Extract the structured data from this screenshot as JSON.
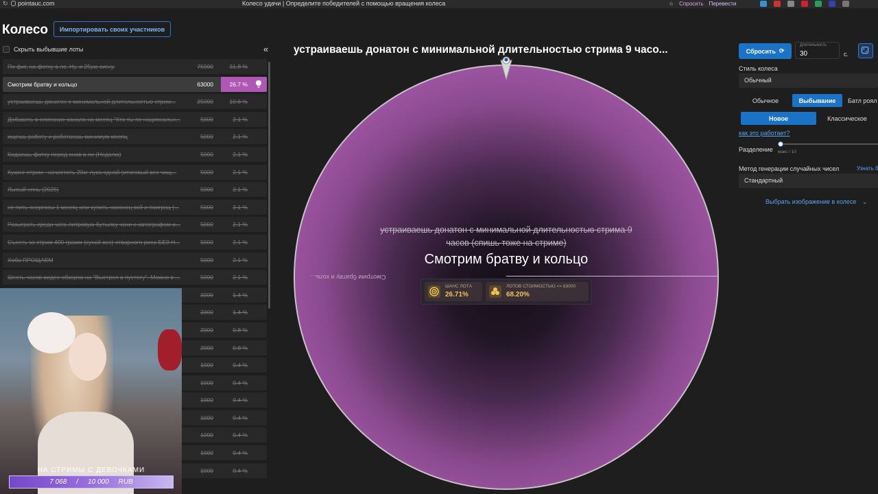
{
  "browser": {
    "url": "pointauc.com",
    "page_title": "Колесо удачи | Определите победителей с помощью вращения колеса",
    "ext_ask": "Спросить",
    "ext_translate": "Перевести"
  },
  "header": {
    "title": "Колесо",
    "import_label": "Импортировать своих участников"
  },
  "sidebar": {
    "hide_lots_label": "Скрыть выбывшие лоты",
    "collapse_icon": "«",
    "lots": [
      {
        "title": "По фиг, на фотку в лс. Ну, и 25ую сигну.",
        "amount": "75000",
        "percent": "31.8 %"
      },
      {
        "title": "Смотрим братву и кольцо",
        "amount": "63000",
        "percent": "26.7 %",
        "active": true
      },
      {
        "title": "устраиваешь донатон с минимальной длительностью стрим...",
        "amount": "25000",
        "percent": "10.6 %"
      },
      {
        "title": "Добавить в описание канала на месяц \"Кто ты по национальн...",
        "amount": "5000",
        "percent": "2.1 %"
      },
      {
        "title": "ищешь работу и работаешь минимум месяц",
        "amount": "5000",
        "percent": "2.1 %"
      },
      {
        "title": "Кидаешь фотку перед снов в лс (Неделю)",
        "amount": "5000",
        "percent": "2.1 %"
      },
      {
        "title": "Кукинг стрим - начистить 20кг лука одной (итоговый вес чищ...",
        "amount": "5000",
        "percent": "2.1 %"
      },
      {
        "title": "Лысый нянь (2025)",
        "amount": "5000",
        "percent": "2.1 %"
      },
      {
        "title": "не пить энергосы 1 месяц или купить наконец вк3 и поиграц (...",
        "amount": "5000",
        "percent": "2.1 %"
      },
      {
        "title": "Разыграть среди чата литровую бутылку чачи с автографом и...",
        "amount": "5000",
        "percent": "2.1 %"
      },
      {
        "title": "Съесть за стрим 400 грамм (сухой вес) отварного риса БЕЗ Н...",
        "amount": "5000",
        "percent": "2.1 %"
      },
      {
        "title": "Хоба ПРОЩАЕМ",
        "amount": "5000",
        "percent": "2.1 %"
      },
      {
        "title": "Шесть часов видео обзоров на \"Выстрел в пустоту\". Можно в ...",
        "amount": "5000",
        "percent": "2.1 %"
      },
      {
        "title": "",
        "amount": "3300",
        "percent": "1.4 %"
      },
      {
        "title": "",
        "amount": "3300",
        "percent": "1.4 %"
      },
      {
        "title": "",
        "amount": "2000",
        "percent": "0.8 %"
      },
      {
        "title": "",
        "amount": "2000",
        "percent": "0.8 %"
      },
      {
        "title": "",
        "amount": "1000",
        "percent": "0.4 %"
      },
      {
        "title": "",
        "amount": "1000",
        "percent": "0.4 %"
      },
      {
        "title": "",
        "amount": "1000",
        "percent": "0.4 %"
      },
      {
        "title": "",
        "amount": "1000",
        "percent": "0.4 %"
      },
      {
        "title": "",
        "amount": "1000",
        "percent": "0.4 %"
      },
      {
        "title": "",
        "amount": "1000",
        "percent": "0.4 %"
      },
      {
        "title": "",
        "amount": "1000",
        "percent": "0.4 %"
      }
    ]
  },
  "webcam": {
    "banner_label": "НА СТРИМЫ С ДЕВОЧКАМИ",
    "progress_current": "7 068",
    "progress_sep": "/",
    "progress_goal": "10 000",
    "progress_currency": "RUB",
    "progress_fraction": 0.7068
  },
  "wheel": {
    "title": "устраиваешь донатон с минимальной длительностью стрима 9 часо...",
    "sector_label": "Смотрим братву и коль...",
    "previous_winner": "устраиваешь донатон с минимальной длительностью стрима 9 часов (спишь тоже на стриме)",
    "current_winner": "Смотрим братву и кольцо",
    "stat1_caption": "ШАНС ЛОТА",
    "stat1_value": "26.71%",
    "stat2_caption": "ЛОТОВ СТОИМОСТЬЮ <= 63000",
    "stat2_value": "68.20%",
    "color": "#b056b5"
  },
  "controls": {
    "reset_label": "Сбросить",
    "duration_caption": "Длительность",
    "duration_value": "30",
    "duration_unit": "с.",
    "wheel_style_label": "Стиль колеса",
    "wheel_style_value": "Обычный",
    "mode_tabs": [
      "Обычное",
      "Выбывание",
      "Батл роял"
    ],
    "mode_selected": "Выбывание",
    "variant_tabs": [
      "Новое",
      "Классическое"
    ],
    "variant_selected": "Новое",
    "how_link": "как это работает?",
    "split_label": "Разделение",
    "split_caption": "макс / 10",
    "rng_label": "Метод генерации случайных чисел",
    "rng_link": "Узнать б",
    "rng_value": "Стандартный",
    "image_link": "Выбрать изображение в колесе"
  }
}
